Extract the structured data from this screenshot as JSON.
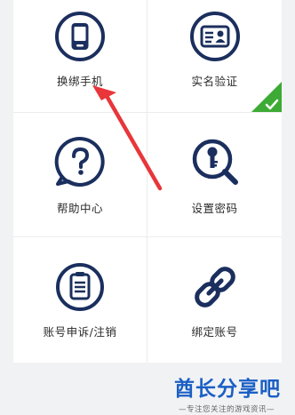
{
  "menu": {
    "items": [
      {
        "label": "换绑手机",
        "icon": "phone-icon"
      },
      {
        "label": "实名验证",
        "icon": "id-card-icon",
        "badge": "verified-check"
      },
      {
        "label": "帮助中心",
        "icon": "help-icon"
      },
      {
        "label": "设置密码",
        "icon": "key-search-icon"
      },
      {
        "label": "账号申诉/注销",
        "icon": "clipboard-icon"
      },
      {
        "label": "绑定账号",
        "icon": "link-icon"
      }
    ]
  },
  "brand": {
    "title": "酋长分享吧",
    "subtitle": "—专注您关注的游戏资讯—"
  },
  "colors": {
    "icon_navy": "#1b2f5e",
    "verified_green": "#3daa35",
    "arrow_red": "#e8363a",
    "brand_blue": "#1a5fc4"
  }
}
